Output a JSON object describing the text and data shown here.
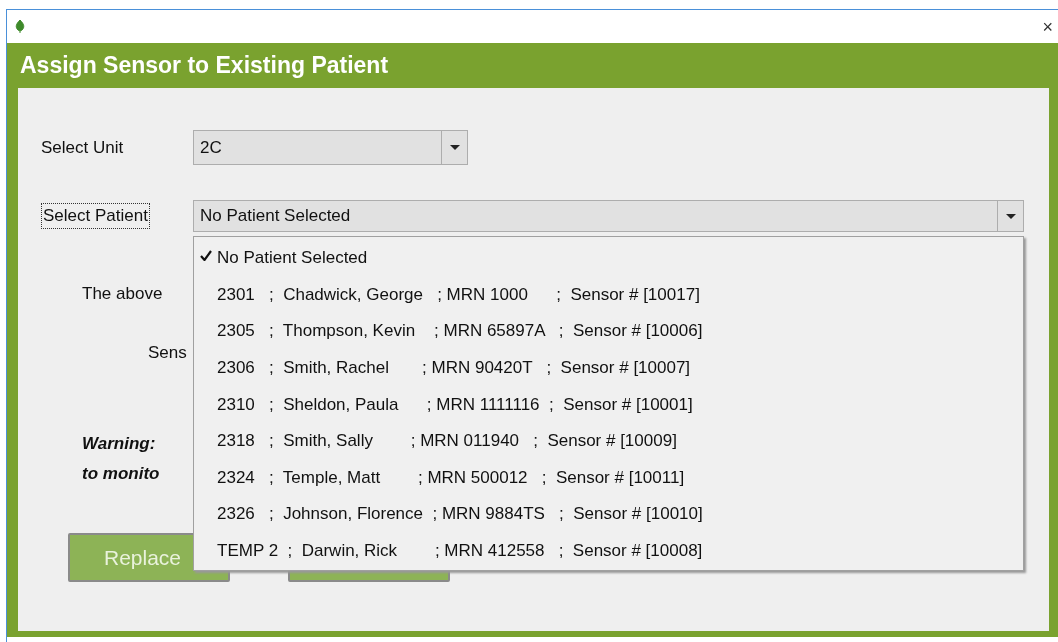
{
  "window": {
    "close_glyph": "×"
  },
  "header": {
    "title": "Assign Sensor to Existing Patient"
  },
  "unit": {
    "label": "Select Unit",
    "value": "2C"
  },
  "patient": {
    "label": "Select Patient",
    "focused": true,
    "value": "No Patient Selected",
    "expanded": true,
    "options": [
      {
        "text": "No Patient Selected",
        "selected": true
      },
      {
        "text": "2301   ;  Chadwick, George   ; MRN 1000      ;  Sensor # [10017]",
        "selected": false
      },
      {
        "text": "2305   ;  Thompson, Kevin    ; MRN 65897A   ;  Sensor # [10006]",
        "selected": false
      },
      {
        "text": "2306   ;  Smith, Rachel       ; MRN 90420T   ;  Sensor # [10007]",
        "selected": false
      },
      {
        "text": "2310   ;  Sheldon, Paula      ; MRN 1111116  ;  Sensor # [10001]",
        "selected": false
      },
      {
        "text": "2318   ;  Smith, Sally        ; MRN 011940   ;  Sensor # [10009]",
        "selected": false
      },
      {
        "text": "2324   ;  Temple, Matt        ; MRN 500012   ;  Sensor # [10011]",
        "selected": false
      },
      {
        "text": "2326   ;  Johnson, Florence  ; MRN 9884TS   ;  Sensor # [10010]",
        "selected": false
      },
      {
        "text": "TEMP 2  ;  Darwin, Rick        ; MRN 412558   ;  Sensor # [10008]",
        "selected": false
      }
    ]
  },
  "info_text": "The above",
  "sensor_label": "Sens",
  "warning_lines": [
    "Warning:",
    "to monito"
  ],
  "buttons": [
    {
      "kind": "labeled",
      "label": "Replace"
    },
    {
      "kind": "blank"
    }
  ]
}
